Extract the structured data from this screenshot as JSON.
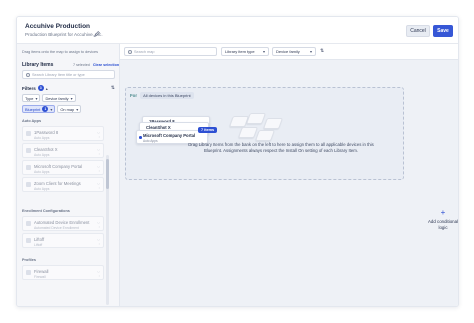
{
  "header": {
    "title": "Accuhive Production",
    "subtitle": "Production Blueprint for Accuhive, Inc.",
    "cancel_label": "Cancel",
    "save_label": "Save",
    "edit_icon": "pencil-icon"
  },
  "sidebar": {
    "hint": "Drag items onto the map to assign to devices",
    "library_title": "Library Items",
    "selected_text": "7 selected",
    "clear_label": "Clear selection",
    "search_placeholder": "Search Library Item title or type",
    "filters_label": "Filters",
    "filters_count": "3",
    "chips_row1": [
      {
        "label": "Type"
      },
      {
        "label": "Device family"
      }
    ],
    "chips_row2": [
      {
        "label": "Blueprint",
        "badge": "1"
      },
      {
        "label": "On map"
      }
    ],
    "sections": [
      {
        "label": "Auto Apps",
        "items": [
          {
            "name": "1Password 8",
            "sub": "Auto Apps"
          },
          {
            "name": "CleanShot X",
            "sub": "Auto Apps"
          },
          {
            "name": "Microsoft Company Portal",
            "sub": "Auto Apps"
          },
          {
            "name": "Zoom Client for Meetings",
            "sub": "Auto Apps"
          }
        ]
      },
      {
        "label": "Enrollment Configurations",
        "items": [
          {
            "name": "Automated Device Enrollment",
            "sub": "Automated Device Enrollment"
          },
          {
            "name": "Liftoff",
            "sub": "Liftoff"
          }
        ]
      },
      {
        "label": "Profiles",
        "items": [
          {
            "name": "Firewall",
            "sub": "Firewall"
          }
        ]
      }
    ]
  },
  "toolbar": {
    "search_placeholder": "Search map",
    "library_item_type": "Library item type",
    "device_family": "Device family"
  },
  "map": {
    "for_label": "For",
    "for_value": "All devices in this Blueprint",
    "drop_text": "Drag Library Items from the bank on the left to here to assign them to all applicable devices in this Blueprint. Assignments always respect the Install On setting of each Library Item.",
    "stack_cards": [
      {
        "name": "1Password 8",
        "sub": "Auto Apps"
      },
      {
        "name": "CleanShot X",
        "sub": "Auto Apps"
      },
      {
        "name": "Microsoft Company Portal",
        "sub": "Auto Apps"
      }
    ],
    "items_badge": "7 items",
    "add_logic_label": "Add conditional logic"
  },
  "colors": {
    "accent": "#3657d6",
    "sidebar_bg": "#f5f6f9",
    "canvas_bg": "#eef1f6"
  }
}
